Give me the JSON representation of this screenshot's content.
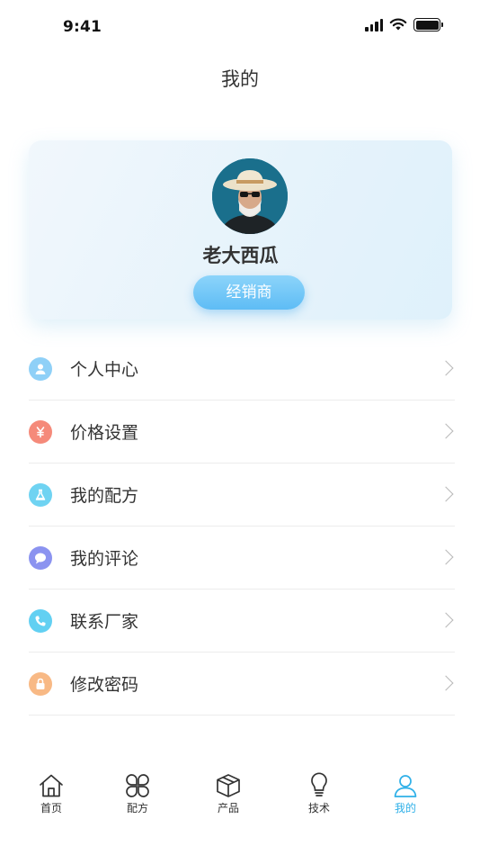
{
  "status_bar": {
    "time": "9:41",
    "battery_level": 1.0
  },
  "header": {
    "title": "我的"
  },
  "profile": {
    "name": "老大西瓜",
    "role_label": "经销商",
    "avatar_icon": "user-photo-cowboy-hat"
  },
  "menu": {
    "items": [
      {
        "label": "个人中心",
        "icon": "person-icon",
        "color": "#8fd0f7"
      },
      {
        "label": "价格设置",
        "icon": "yuan-icon",
        "color": "#f58a7a"
      },
      {
        "label": "我的配方",
        "icon": "flask-icon",
        "color": "#6fd3f2"
      },
      {
        "label": "我的评论",
        "icon": "chat-bubble-icon",
        "color": "#8b93f0"
      },
      {
        "label": "联系厂家",
        "icon": "phone-icon",
        "color": "#62d0f2"
      },
      {
        "label": "修改密码",
        "icon": "lock-icon",
        "color": "#f8b985"
      }
    ]
  },
  "tabbar": {
    "active": "我的",
    "active_color": "#2fb0e8",
    "tabs": [
      {
        "label": "首页",
        "icon": "home-icon"
      },
      {
        "label": "配方",
        "icon": "clover-icon"
      },
      {
        "label": "产品",
        "icon": "box-icon"
      },
      {
        "label": "技术",
        "icon": "lightbulb-icon"
      },
      {
        "label": "我的",
        "icon": "person-outline-icon"
      }
    ]
  }
}
